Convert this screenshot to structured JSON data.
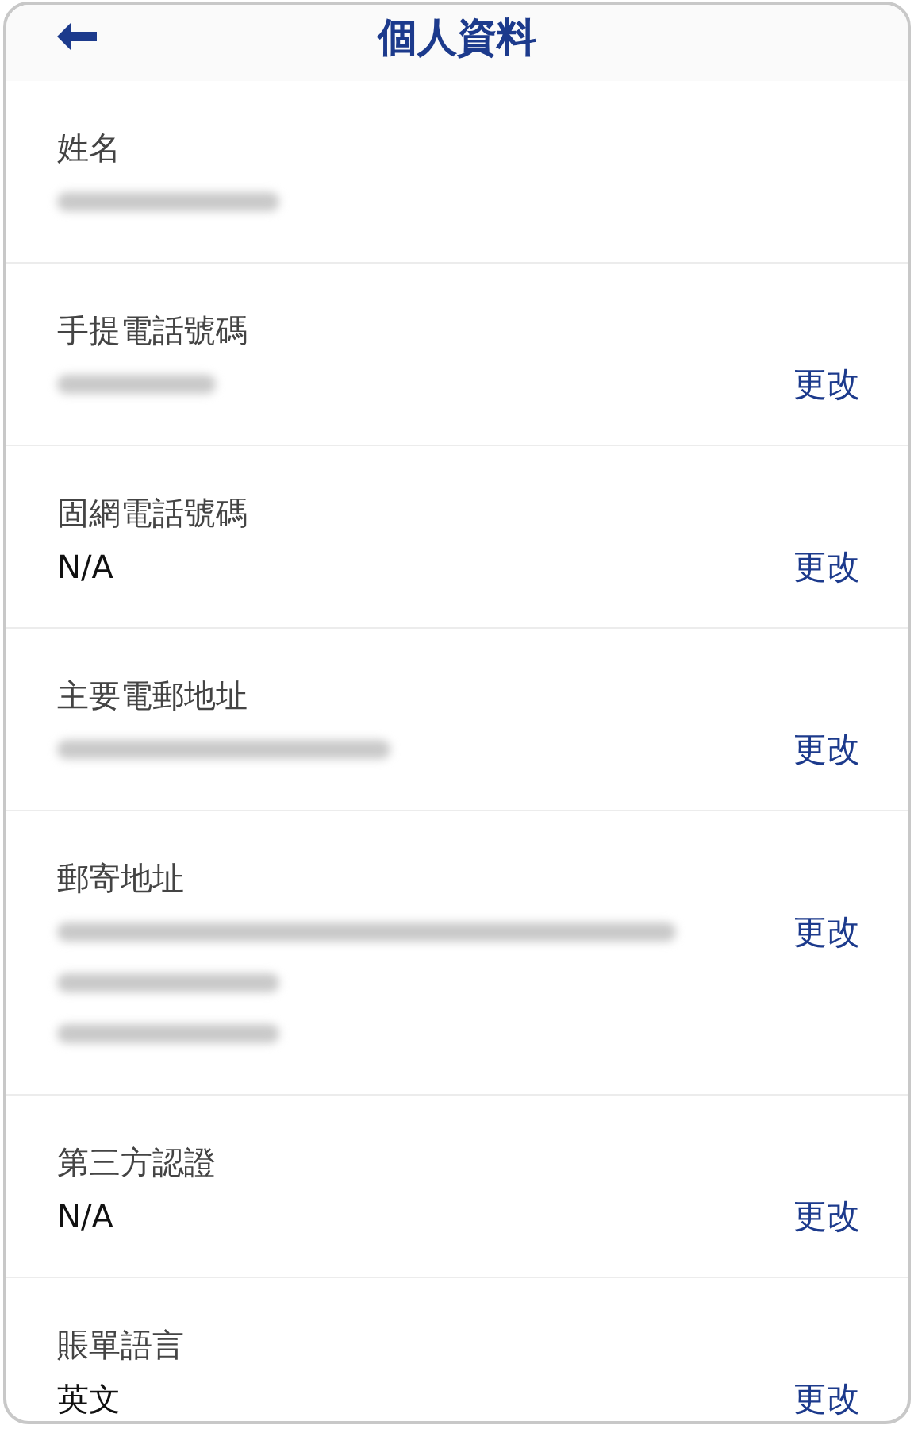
{
  "header": {
    "title": "個人資料"
  },
  "fields": [
    {
      "label": "姓名",
      "value": {
        "kind": "blurred",
        "lines": [
          {
            "blurred": true
          }
        ]
      }
    },
    {
      "label": "手提電話號碼",
      "value": {
        "kind": "blurred",
        "lines": [
          {
            "blurred": true
          }
        ]
      },
      "action": "更改"
    },
    {
      "label": "固網電話號碼",
      "value": {
        "kind": "text",
        "text": "N/A"
      },
      "action": "更改"
    },
    {
      "label": "主要電郵地址",
      "value": {
        "kind": "blurred",
        "lines": [
          {
            "blurred": true
          }
        ]
      },
      "action": "更改"
    },
    {
      "label": "郵寄地址",
      "value": {
        "kind": "blurred",
        "lines": [
          {
            "blurred": true
          },
          {
            "blurred": true
          },
          {
            "blurred": true
          }
        ]
      },
      "action": "更改"
    },
    {
      "label": "第三方認證",
      "value": {
        "kind": "text",
        "text": "N/A"
      },
      "action": "更改"
    },
    {
      "label": "賬單語言",
      "value": {
        "kind": "text",
        "text": "英文"
      },
      "action": "更改"
    }
  ]
}
